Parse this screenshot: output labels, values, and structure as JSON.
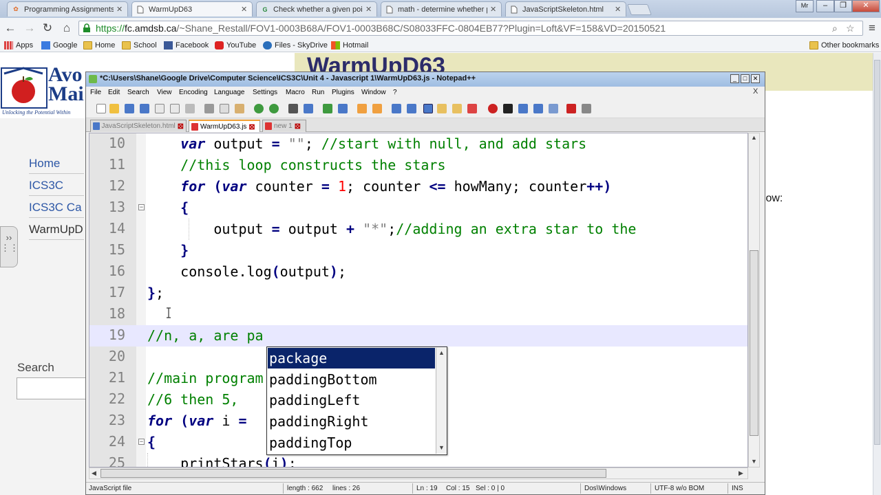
{
  "browser": {
    "tabs": [
      {
        "title": "Programming Assignments In"
      },
      {
        "title": "WarmUpD63"
      },
      {
        "title": "Check whether a given point"
      },
      {
        "title": "math - determine whether p"
      },
      {
        "title": "JavaScriptSkeleton.html"
      }
    ],
    "user_badge": "Mr",
    "url_scheme": "https://",
    "url_host": "fc.amdsb.ca",
    "url_path": "/~Shane_Restall/FOV1-0003B68A/FOV1-0003B68C/S08033FFC-0804EB77?Plugin=Loft&VF=158&VD=20150521",
    "bookmarks": [
      "Apps",
      "Google",
      "Home",
      "School",
      "Facebook",
      "YouTube",
      "Files - SkyDrive",
      "Hotmail"
    ],
    "other_bookmarks": "Other bookmarks"
  },
  "webpage": {
    "logo_text_1": "Avo",
    "logo_text_2": "Mai",
    "logo_tagline": "Unlocking the Potential Within",
    "title": "WarmUpD63",
    "nav": [
      "Home",
      "ICS3C",
      "ICS3C Ca",
      "WarmUpD"
    ],
    "search_label": "Search",
    "body_text": "elow:"
  },
  "npp": {
    "title": "*C:\\Users\\Shane\\Google Drive\\Computer Science\\ICS3C\\Unit 4 - Javascript 1\\WarmUpD63.js - Notepad++",
    "menu": [
      "File",
      "Edit",
      "Search",
      "View",
      "Encoding",
      "Language",
      "Settings",
      "Macro",
      "Run",
      "Plugins",
      "Window",
      "?"
    ],
    "close_doc": "X",
    "tabs": [
      {
        "name": "JavaScriptSkeleton.html",
        "active": false
      },
      {
        "name": "WarmUpD63.js",
        "active": true
      },
      {
        "name": "new 1",
        "active": false
      }
    ],
    "line_numbers": [
      "10",
      "11",
      "12",
      "13",
      "14",
      "15",
      "16",
      "17",
      "18",
      "19",
      "20",
      "21",
      "22",
      "23",
      "24",
      "25"
    ],
    "autocomplete": [
      "package",
      "paddingBottom",
      "paddingLeft",
      "paddingRight",
      "paddingTop"
    ],
    "status": {
      "lang": "JavaScript file",
      "length": "length : 662",
      "lines": "lines : 26",
      "ln": "Ln : 19",
      "col": "Col : 15",
      "sel": "Sel : 0 | 0",
      "eol": "Dos\\Windows",
      "enc": "UTF-8 w/o BOM",
      "ins": "INS"
    }
  },
  "colors": {
    "keyword": "#000080",
    "comment": "#008000",
    "string": "#808080",
    "number": "#ff0000",
    "selection": "#0a246a",
    "current_line": "#e8e8ff"
  }
}
